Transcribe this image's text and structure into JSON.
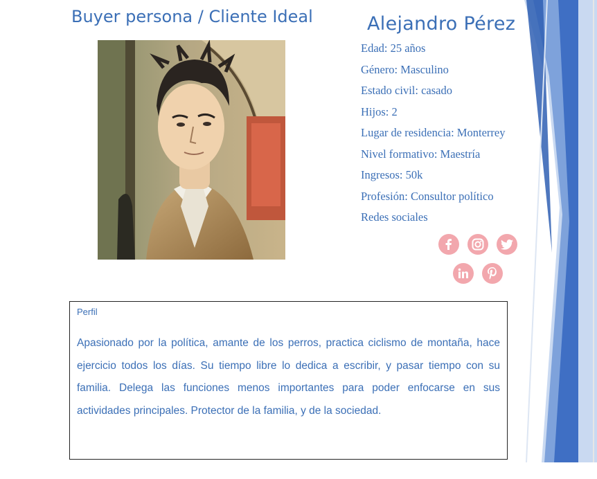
{
  "header": {
    "title": "Buyer persona / Cliente Ideal"
  },
  "persona": {
    "name": "Alejandro Pérez",
    "attributes": [
      "Edad: 25 años",
      "Género: Masculino",
      "Estado civil: casado",
      "Hijos: 2",
      "Lugar de residencia: Monterrey",
      "Nivel formativo: Maestría",
      "Ingresos: 50k",
      "Profesión: Consultor político",
      "Redes sociales"
    ]
  },
  "social_icons": [
    "facebook-icon",
    "instagram-icon",
    "twitter-icon",
    "linkedin-icon",
    "pinterest-icon"
  ],
  "profile": {
    "label": "Perfil",
    "text": "Apasionado por la política, amante de los perros, practica ciclismo de montaña, hace ejercicio todos los días. Su tiempo libre lo dedica a escribir, y pasar tiempo con su familia. Delega las funciones menos importantes para poder enfocarse en sus actividades principales. Protector de la familia, y de la sociedad."
  },
  "colors": {
    "text": "#3b6fb6",
    "social_icon_bg": "#f2a7ad",
    "deco_dark": "#3f6fc4",
    "deco_light": "#a9c3e8"
  }
}
